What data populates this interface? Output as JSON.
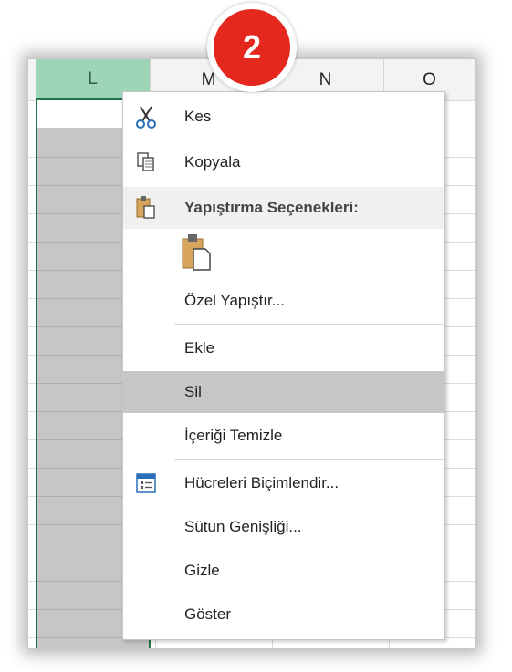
{
  "badge": {
    "number": "2",
    "color": "#e5281e"
  },
  "columns": [
    {
      "label": "L",
      "selected": true
    },
    {
      "label": "M",
      "selected": false
    },
    {
      "label": "N",
      "selected": false
    },
    {
      "label": "O",
      "selected": false
    }
  ],
  "menu": {
    "cut": "Kes",
    "copy": "Kopyala",
    "paste_options_header": "Yapıştırma Seçenekleri:",
    "paste_special": "Özel Yapıştır...",
    "insert": "Ekle",
    "delete": "Sil",
    "clear_contents": "İçeriği Temizle",
    "format_cells": "Hücreleri Biçimlendir...",
    "column_width": "Sütun Genişliği...",
    "hide": "Gizle",
    "unhide": "Göster"
  },
  "icons": {
    "cut": "scissors-icon",
    "copy": "copy-icon",
    "paste_header": "paste-clipboard-icon",
    "paste_option": "paste-icon",
    "format_cells": "format-cells-icon"
  },
  "colors": {
    "selected_header": "#9fd5b7",
    "selection_border": "#217346",
    "highlight": "#c6c6c6"
  }
}
